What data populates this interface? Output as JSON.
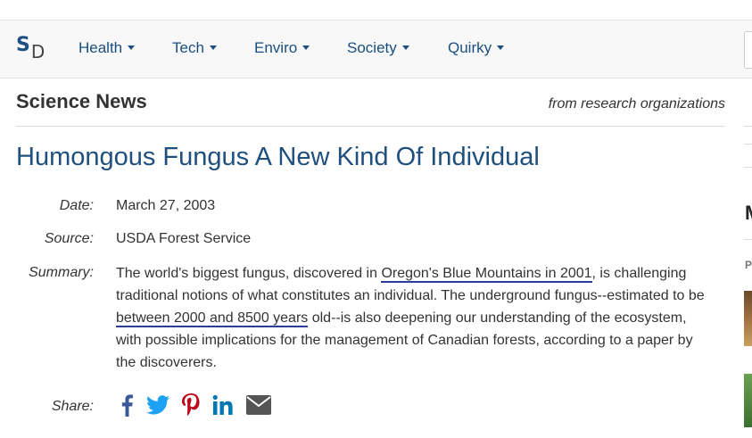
{
  "logo": {
    "s": "S",
    "d": "D"
  },
  "nav": {
    "items": [
      {
        "label": "Health"
      },
      {
        "label": "Tech"
      },
      {
        "label": "Enviro"
      },
      {
        "label": "Society"
      },
      {
        "label": "Quirky"
      }
    ]
  },
  "section": {
    "heading": "Science News",
    "subheading": "from research organizations"
  },
  "article": {
    "title": "Humongous Fungus A New Kind Of Individual",
    "date_label": "Date:",
    "date": "March 27, 2003",
    "source_label": "Source:",
    "source": "USDA Forest Service",
    "summary_label": "Summary:",
    "summary_parts": [
      "The world's biggest fungus, discovered in ",
      "Oregon's Blue Mountains in 2001",
      ", is challenging traditional notions of what constitutes an individual. The underground fungus--estimated to be ",
      "between 2000 and 8500 years",
      " old--is also deepening our understanding of the ecosystem, with possible implications for the management of Canadian forests, according to a paper by the discoverers."
    ],
    "share_label": "Share:"
  },
  "share_icons": [
    "facebook-icon",
    "twitter-icon",
    "pinterest-icon",
    "linkedin-icon",
    "email-icon"
  ],
  "sidebar": {
    "heading_letter": "M",
    "sub_letter": "P"
  },
  "colors": {
    "brand": "#1f4f7d",
    "facebook": "#3b5998",
    "twitter": "#1da1f2",
    "pinterest": "#bd081c",
    "linkedin": "#0077b5",
    "email": "#555555",
    "annotation": "#2a3f9a"
  }
}
